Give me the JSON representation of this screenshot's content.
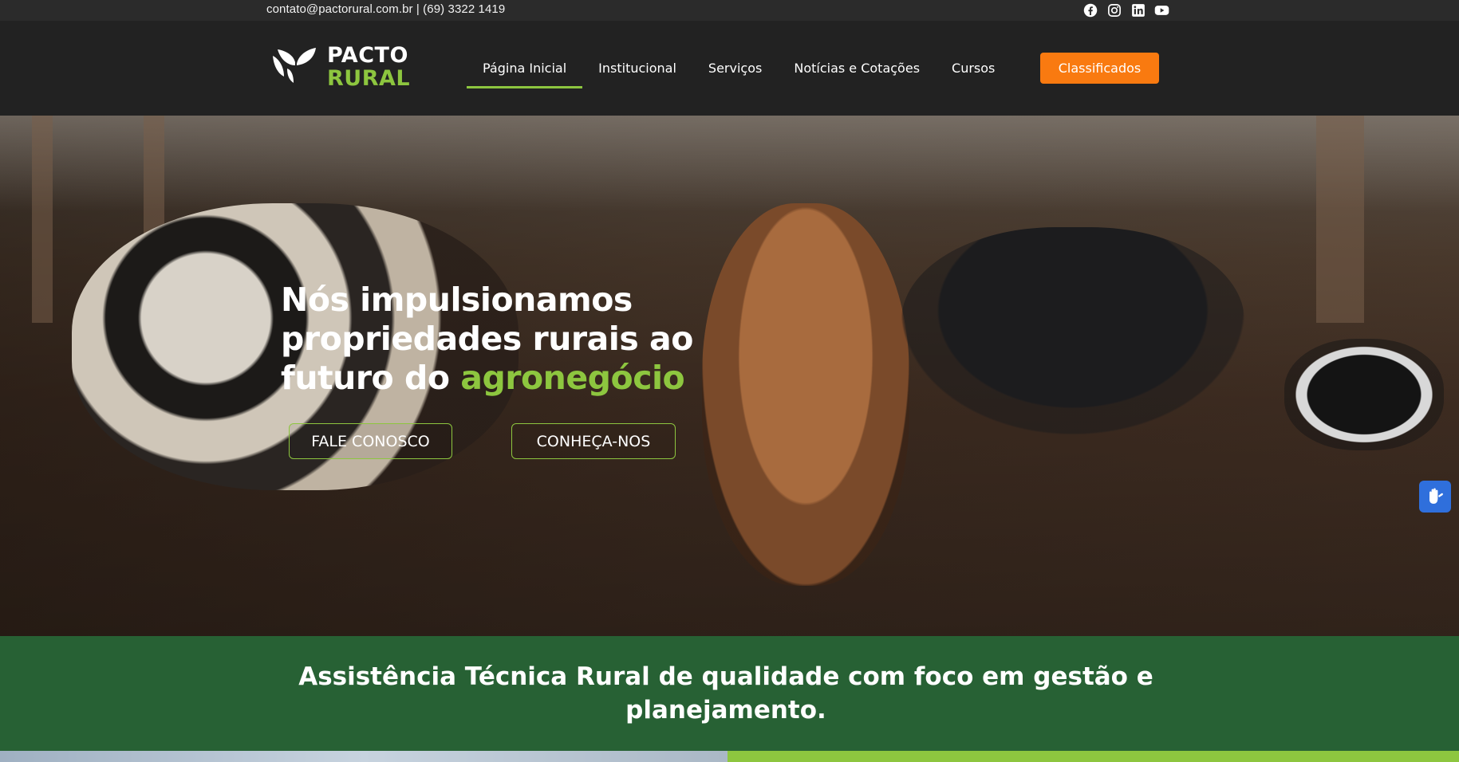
{
  "topbar": {
    "contact": "contato@pactorural.com.br | (69) 3322 1419",
    "social_icons": [
      "facebook-icon",
      "instagram-icon",
      "linkedin-icon",
      "youtube-icon"
    ]
  },
  "header": {
    "logo": {
      "line1": "PACTO",
      "line2": "RURAL"
    },
    "nav": [
      {
        "label": "Página Inicial",
        "active": true
      },
      {
        "label": "Institucional"
      },
      {
        "label": "Serviços"
      },
      {
        "label": "Notícias e Cotações"
      },
      {
        "label": "Cursos"
      }
    ],
    "cta": "Classificados"
  },
  "hero": {
    "title_part1": "Nós impulsionamos propriedades rurais ao futuro do",
    "title_accent": "agronegócio",
    "button1": "FALE CONOSCO",
    "button2": "CONHEÇA-NOS"
  },
  "band": {
    "title": "Assistência Técnica Rural de qualidade com foco em gestão e planejamento."
  },
  "colors": {
    "accent_green": "#8dc63f",
    "band_green": "#276134",
    "cta_orange": "#f97a10",
    "header_dark": "#222222",
    "accessibility_blue": "#2f6fdc"
  }
}
